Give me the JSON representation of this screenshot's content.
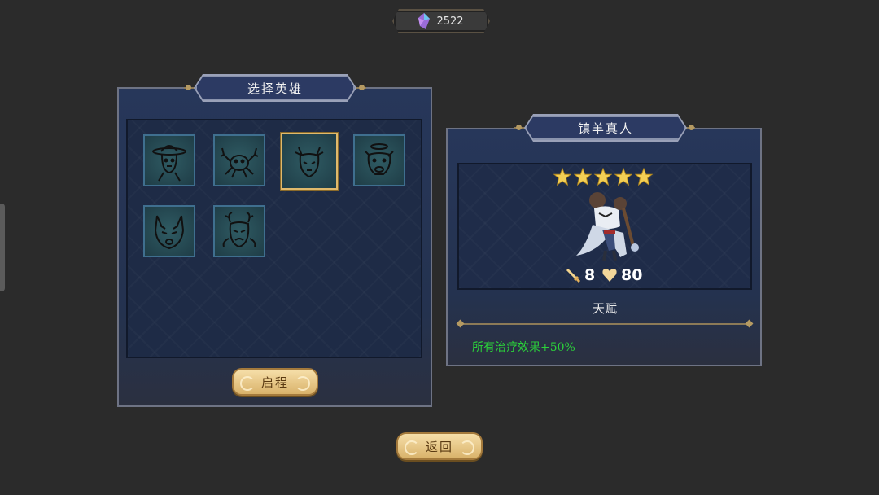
{
  "currency": {
    "amount": "2522",
    "icon": "crystal-gem-icon"
  },
  "select_panel": {
    "title": "选择英雄",
    "heroes": [
      {
        "name": "hero-hat-man",
        "selected": false
      },
      {
        "name": "hero-crab",
        "selected": false
      },
      {
        "name": "hero-goat",
        "selected": true
      },
      {
        "name": "hero-pig",
        "selected": false
      },
      {
        "name": "hero-wolf",
        "selected": false
      },
      {
        "name": "hero-horned-demon",
        "selected": false
      }
    ],
    "start_button": "启程"
  },
  "detail_panel": {
    "title": "镇羊真人",
    "stars": 5,
    "attack": "8",
    "health": "80",
    "talent_title": "天赋",
    "talent_desc": "所有治疗效果+50%"
  },
  "back_button": "返回",
  "colors": {
    "gold": "#e0b96c",
    "talent_green": "#2bd13a",
    "panel_blue": "#27375a"
  }
}
